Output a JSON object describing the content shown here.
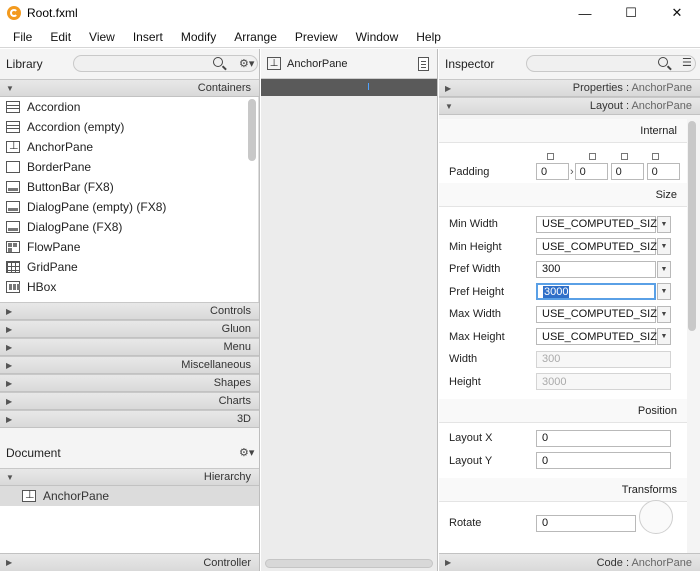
{
  "window": {
    "title": "Root.fxml",
    "minimize": "—",
    "maximize": "☐",
    "close": "✕"
  },
  "menu": [
    "File",
    "Edit",
    "View",
    "Insert",
    "Modify",
    "Arrange",
    "Preview",
    "Window",
    "Help"
  ],
  "library": {
    "title": "Library",
    "gear": "⚙▾",
    "containers_label": "Containers",
    "items": [
      {
        "label": "Accordion",
        "icon": "rows"
      },
      {
        "label": "Accordion  (empty)",
        "icon": "rows"
      },
      {
        "label": "AnchorPane",
        "icon": "anchor"
      },
      {
        "label": "BorderPane",
        "icon": "plain"
      },
      {
        "label": "ButtonBar  (FX8)",
        "icon": "bar"
      },
      {
        "label": "DialogPane (empty)  (FX8)",
        "icon": "bar"
      },
      {
        "label": "DialogPane  (FX8)",
        "icon": "bar"
      },
      {
        "label": "FlowPane",
        "icon": "flow"
      },
      {
        "label": "GridPane",
        "icon": "grid"
      },
      {
        "label": "HBox",
        "icon": "hbox"
      }
    ],
    "sections": [
      "Controls",
      "Gluon",
      "Menu",
      "Miscellaneous",
      "Shapes",
      "Charts",
      "3D"
    ]
  },
  "document": {
    "title": "Document",
    "gear": "⚙▾",
    "hierarchy_label": "Hierarchy",
    "hierarchy_item": "AnchorPane",
    "controller_label": "Controller"
  },
  "center": {
    "title": "AnchorPane"
  },
  "inspector": {
    "title": "Inspector",
    "properties_label": "Properties",
    "properties_target": "AnchorPane",
    "layout_label": "Layout",
    "layout_target": "AnchorPane",
    "internal_label": "Internal",
    "padding_label": "Padding",
    "padding_values": [
      "0",
      "0",
      "0",
      "0"
    ],
    "padding_arrow": "›",
    "size_label": "Size",
    "size_rows": [
      {
        "label": "Min Width",
        "value": "USE_COMPUTED_SIZE",
        "kind": "combo"
      },
      {
        "label": "Min Height",
        "value": "USE_COMPUTED_SIZE",
        "kind": "combo"
      },
      {
        "label": "Pref Width",
        "value": "300",
        "kind": "combo"
      },
      {
        "label": "Pref Height",
        "value": "3000",
        "kind": "focus"
      },
      {
        "label": "Max Width",
        "value": "USE_COMPUTED_SIZE",
        "kind": "combo"
      },
      {
        "label": "Max Height",
        "value": "USE_COMPUTED_SIZE",
        "kind": "combo"
      },
      {
        "label": "Width",
        "value": "300",
        "kind": "disabled"
      },
      {
        "label": "Height",
        "value": "3000",
        "kind": "disabled"
      }
    ],
    "position_label": "Position",
    "layout_x_label": "Layout X",
    "layout_x_value": "0",
    "layout_y_label": "Layout Y",
    "layout_y_value": "0",
    "transforms_label": "Transforms",
    "rotate_label": "Rotate",
    "rotate_value": "0",
    "code_label": "Code",
    "code_target": "AnchorPane"
  }
}
